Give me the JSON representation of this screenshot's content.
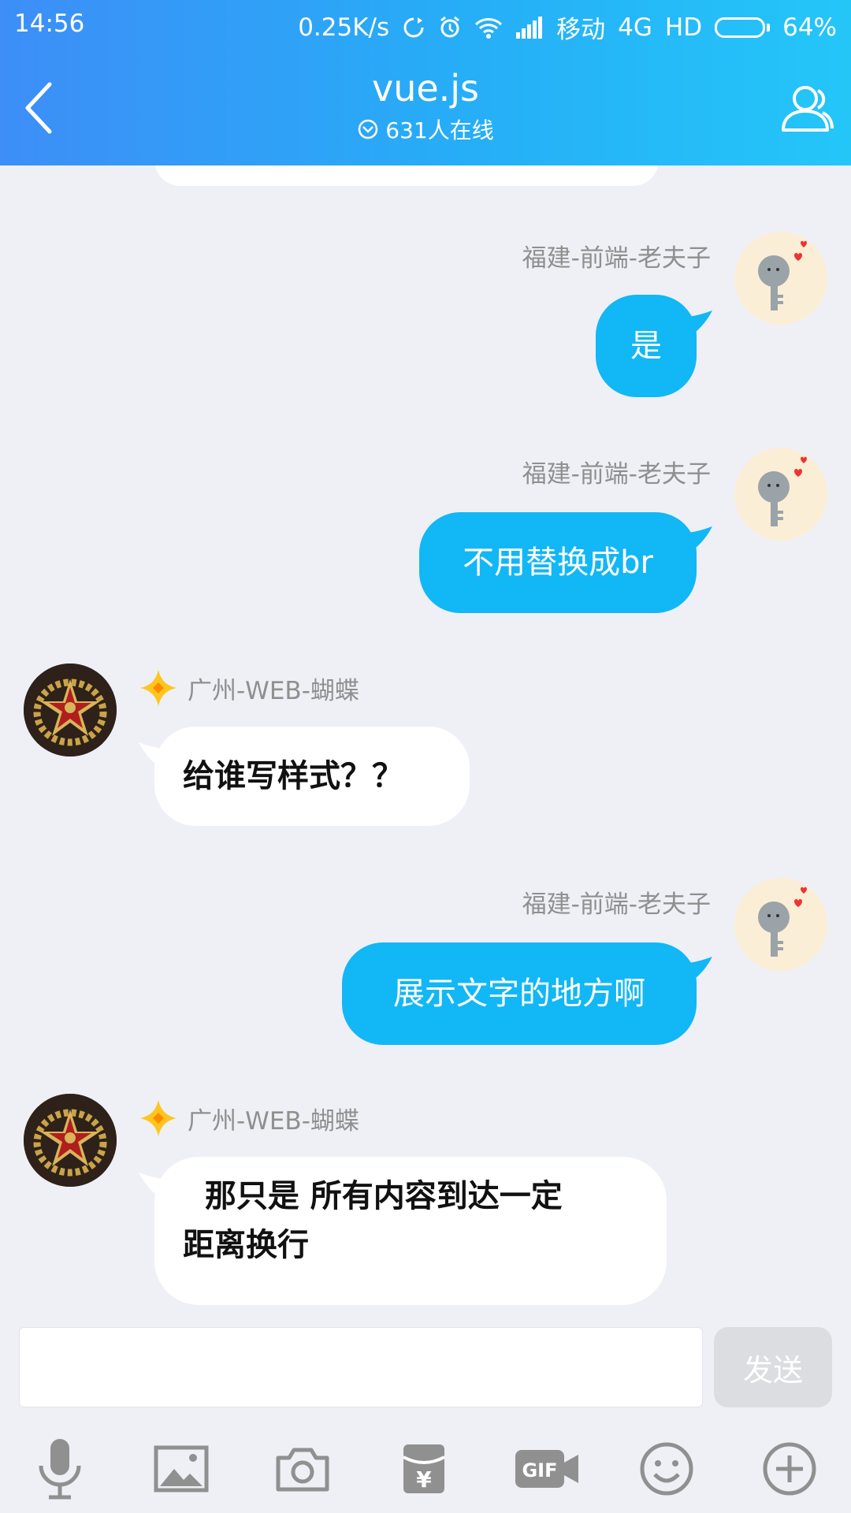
{
  "status_bar": {
    "time": "14:56",
    "net_speed": "0.25K/s",
    "carrier": "移动",
    "network": "4G",
    "hd": "HD",
    "battery_percent": "64%",
    "battery_level": 0.64
  },
  "header": {
    "title": "vue.js",
    "online_count": "631人在线",
    "background": "#29aef7"
  },
  "messages": [
    {
      "sender": "福建-前端-老夫子",
      "text": "是",
      "mine": true
    },
    {
      "sender": "福建-前端-老夫子",
      "text": "不用替换成br",
      "mine": true
    },
    {
      "sender": "广州-WEB-蝴蝶",
      "text": "给谁写样式？？",
      "mine": false
    },
    {
      "sender": "福建-前端-老夫子",
      "text": "展示文字的地方啊",
      "mine": true
    },
    {
      "sender": "广州-WEB-蝴蝶",
      "text_line1": "  那只是 所有内容到达一定",
      "text_line2": "距离换行",
      "mine": false
    }
  ],
  "input": {
    "value": "",
    "placeholder": "",
    "send_label": "发送"
  },
  "toolbar": {
    "icons": [
      "microphone-icon",
      "image-icon",
      "camera-icon",
      "red-packet-icon",
      "gif-icon",
      "emoji-icon",
      "plus-icon"
    ],
    "gif_label": "GIF",
    "yuan_label": "¥"
  },
  "colors": {
    "my_bubble": "#12b7f5",
    "their_bubble": "#ffffff",
    "background": "#eef0f6"
  }
}
